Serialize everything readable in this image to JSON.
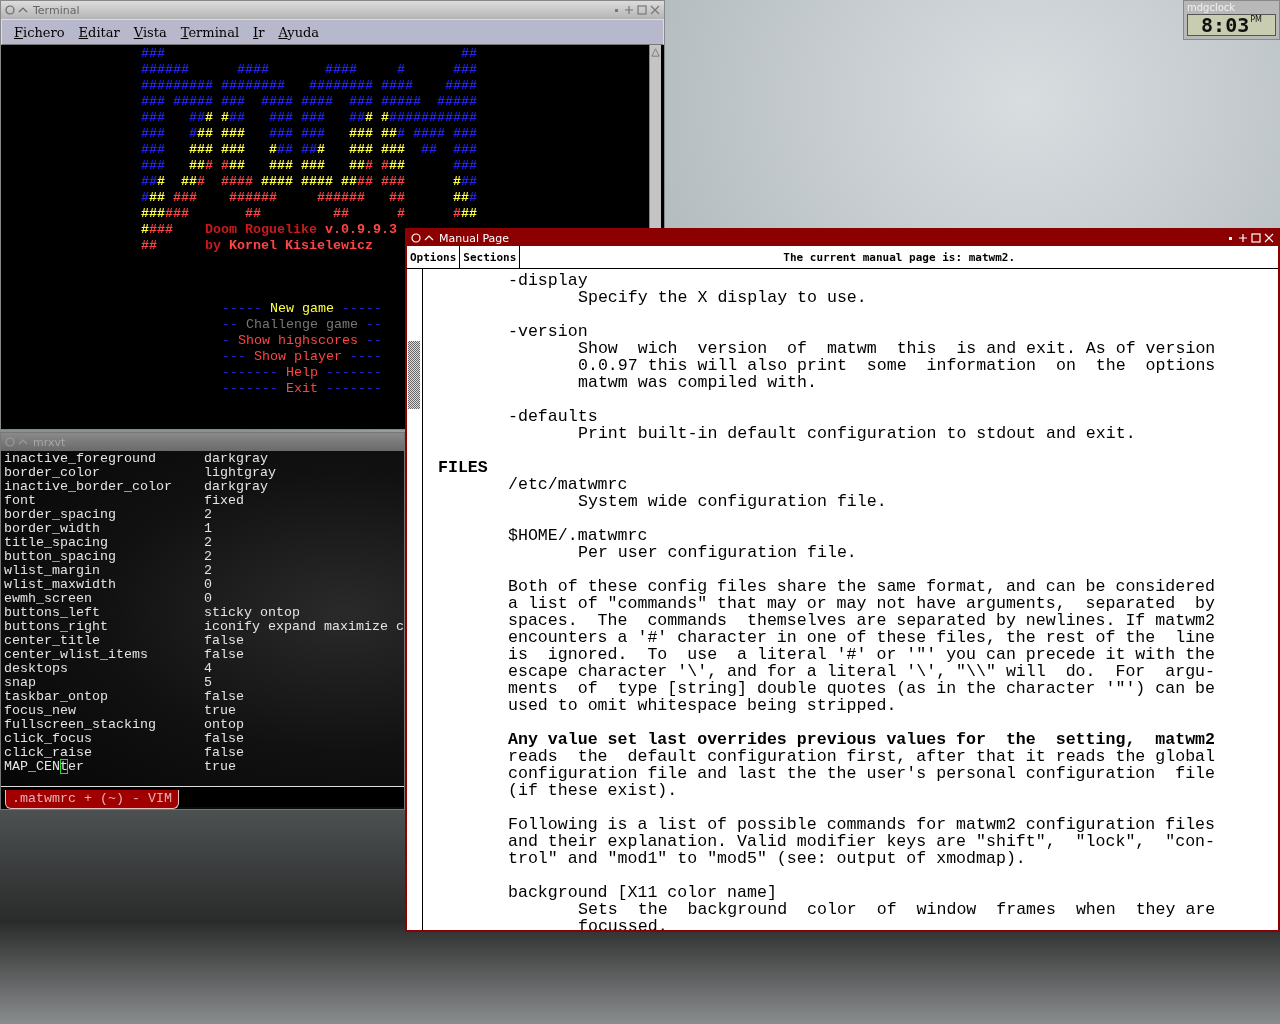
{
  "terminal": {
    "title": "Terminal",
    "menu": [
      "Fichero",
      "Editar",
      "Vista",
      "Terminal",
      "Ir",
      "Ayuda"
    ],
    "art": [
      {
        "segments": [
          {
            "text": "###                                     ##",
            "color": "#2424e8"
          }
        ]
      },
      {
        "segments": [
          {
            "text": "######      ####       ####     #      ###",
            "color": "#2424e8"
          }
        ]
      },
      {
        "segments": [
          {
            "text": "######### ########   ######## ####    ####",
            "color": "#2424e8"
          }
        ]
      },
      {
        "segments": [
          {
            "text": "### ##### ###  #### ####  ### #####  #####",
            "color": "#2424e8"
          }
        ]
      },
      {
        "segments": [
          {
            "text": "###   ##",
            "color": "#2424e8"
          },
          {
            "text": "# #",
            "color": "#ffff44"
          },
          {
            "text": "##   ### ###   ##",
            "color": "#2424e8"
          },
          {
            "text": "# #",
            "color": "#ffff44"
          },
          {
            "text": "###########",
            "color": "#2424e8"
          }
        ]
      },
      {
        "segments": [
          {
            "text": "###   #",
            "color": "#2424e8"
          },
          {
            "text": "## ###",
            "color": "#ffff44"
          },
          {
            "text": "   ### ###   ",
            "color": "#2424e8"
          },
          {
            "text": "### ##",
            "color": "#ffff44"
          },
          {
            "text": "# #### ###",
            "color": "#2424e8"
          }
        ]
      },
      {
        "segments": [
          {
            "text": "###   ",
            "color": "#2424e8"
          },
          {
            "text": "### ###   #",
            "color": "#ffff44"
          },
          {
            "text": "## ##",
            "color": "#2424e8"
          },
          {
            "text": "#   ### ###",
            "color": "#ffff44"
          },
          {
            "text": "  ##  ###",
            "color": "#2424e8"
          }
        ]
      },
      {
        "segments": [
          {
            "text": "###   ",
            "color": "#2424e8"
          },
          {
            "text": "##",
            "color": "#ffff44"
          },
          {
            "text": "# #",
            "color": "#ff4444"
          },
          {
            "text": "##   ### ###   ##",
            "color": "#ffff44"
          },
          {
            "text": "# #",
            "color": "#ff4444"
          },
          {
            "text": "##",
            "color": "#ffff44"
          },
          {
            "text": "      ###",
            "color": "#2424e8"
          }
        ]
      },
      {
        "segments": [
          {
            "text": "##",
            "color": "#2424e8"
          },
          {
            "text": "#  ##",
            "color": "#ffff44"
          },
          {
            "text": "#  ####",
            "color": "#ff4444"
          },
          {
            "text": " #### #### ##",
            "color": "#ffff44"
          },
          {
            "text": "## ###",
            "color": "#ff4444"
          },
          {
            "text": "      #",
            "color": "#ffff44"
          },
          {
            "text": "##",
            "color": "#2424e8"
          }
        ]
      },
      {
        "segments": [
          {
            "text": "#",
            "color": "#2424e8"
          },
          {
            "text": "##",
            "color": "#ffff44"
          },
          {
            "text": " ###    ######     ######   ##      ",
            "color": "#ff4444"
          },
          {
            "text": "##",
            "color": "#ffff44"
          },
          {
            "text": "#",
            "color": "#2424e8"
          }
        ]
      },
      {
        "segments": [
          {
            "text": "###",
            "color": "#ffff44"
          },
          {
            "text": "###       ##         ##      #      #",
            "color": "#ff4444"
          },
          {
            "text": "##",
            "color": "#ffff44"
          }
        ]
      },
      {
        "segments": [
          {
            "text": "#",
            "color": "#ffff44"
          },
          {
            "text": "###",
            "color": "#ff4444"
          },
          {
            "text": "    Doom Roguelike ",
            "color": "#c81c1c"
          },
          {
            "text": "v.0.9.9.3",
            "color": "#ff4444"
          }
        ]
      },
      {
        "segments": [
          {
            "text": "##",
            "color": "#ff4444"
          },
          {
            "text": "      by ",
            "color": "#c81c1c"
          },
          {
            "text": "Kornel Kisielewicz",
            "color": "#ff4444"
          }
        ]
      }
    ],
    "game_menu": [
      {
        "left": "-----",
        "label": "New game",
        "right": "-----",
        "selected": true,
        "disabled": false
      },
      {
        "left": "--",
        "label": "Challenge game",
        "right": "--",
        "selected": false,
        "disabled": true
      },
      {
        "left": "-",
        "label": "Show highscores",
        "right": "--",
        "selected": false,
        "disabled": false
      },
      {
        "left": "---",
        "label": "Show player",
        "right": "----",
        "selected": false,
        "disabled": false
      },
      {
        "left": "-------",
        "label": "Help",
        "right": "-------",
        "selected": false,
        "disabled": false
      },
      {
        "left": "-------",
        "label": "Exit",
        "right": "-------",
        "selected": false,
        "disabled": false
      }
    ]
  },
  "mrxvt": {
    "title": "mrxvt",
    "rows": [
      {
        "key": "inactive_foreground",
        "value": "darkgray"
      },
      {
        "key": "border_color",
        "value": "lightgray"
      },
      {
        "key": "inactive_border_color",
        "value": "darkgray"
      },
      {
        "key": "font",
        "value": "fixed"
      },
      {
        "key": "border_spacing",
        "value": "2"
      },
      {
        "key": "border_width",
        "value": "1"
      },
      {
        "key": "title_spacing",
        "value": "2"
      },
      {
        "key": "button_spacing",
        "value": "2"
      },
      {
        "key": "wlist_margin",
        "value": "2"
      },
      {
        "key": "wlist_maxwidth",
        "value": "0"
      },
      {
        "key": "ewmh_screen",
        "value": "0"
      },
      {
        "key": "buttons_left",
        "value": "sticky ontop"
      },
      {
        "key": "buttons_right",
        "value": "iconify expand maximize c"
      },
      {
        "key": "center_title",
        "value": "false"
      },
      {
        "key": "center_wlist_items",
        "value": "false"
      },
      {
        "key": "desktops",
        "value": "4"
      },
      {
        "key": "snap",
        "value": "5"
      },
      {
        "key": "taskbar_ontop",
        "value": "false"
      },
      {
        "key": "focus_new",
        "value": "true"
      },
      {
        "key": "fullscreen_stacking",
        "value": "ontop"
      },
      {
        "key": "click_focus",
        "value": "false"
      },
      {
        "key": "click_raise",
        "value": "false"
      },
      {
        "key": "MAP_CEN",
        "cursor_char": "t",
        "key_after_cursor": "er",
        "value": "true"
      }
    ],
    "tab": ".matwmrc + (~) - VIM"
  },
  "manual": {
    "title": "Manual Page",
    "buttons": [
      "Options",
      "Sections"
    ],
    "status": "The current manual page is: matwm2.",
    "blocks": [
      {
        "kind": "term",
        "lines": [
          "-display"
        ]
      },
      {
        "kind": "text",
        "lines": [
          "Specify the X display to use."
        ]
      },
      {
        "kind": "term",
        "lines": [
          "-version"
        ]
      },
      {
        "kind": "text",
        "lines": [
          "Show  wich  version  of  matwm  this  is and exit. As of version",
          "0.0.97 this will also print  some  information  on  the  options",
          "matwm was compiled with."
        ]
      },
      {
        "kind": "term",
        "lines": [
          "-defaults"
        ]
      },
      {
        "kind": "text",
        "lines": [
          "Print built-in default configuration to stdout and exit."
        ]
      },
      {
        "kind": "heading",
        "lines": [
          "FILES"
        ]
      },
      {
        "kind": "term",
        "lines": [
          "/etc/matwmrc"
        ]
      },
      {
        "kind": "text",
        "lines": [
          "System wide configuration file."
        ]
      },
      {
        "kind": "term",
        "lines": [
          "$HOME/.matwmrc"
        ]
      },
      {
        "kind": "text",
        "lines": [
          "Per user configuration file."
        ]
      },
      {
        "kind": "para",
        "lines": [
          "Both of these config files share the same format, and can be considered",
          "a list of \"commands\" that may or may not have arguments,  separated  by",
          "spaces.  The  commands  themselves are separated by newlines. If matwm2",
          "encounters a '#' character in one of these files, the rest of the  line",
          "is  ignored.  To  use  a literal '#' or '\"' you can precede it with the",
          "escape character '\\', and for a literal '\\', \"\\\\\" will  do.  For  argu-",
          "ments  of  type [string] double quotes (as in the character '\"') can be",
          "used to omit whitespace being stripped."
        ]
      },
      {
        "kind": "para",
        "lines": [
          "**Any value set last overrides previous values for  the  setting,  matwm2**",
          "reads  the  default configuration first, after that it reads the global",
          "configuration file and last the the user's personal configuration  file",
          "(if these exist)."
        ]
      },
      {
        "kind": "para",
        "lines": [
          "Following is a list of possible commands for matwm2 configuration files",
          "and their explanation. Valid modifier keys are \"shift\",  \"lock\",  \"con-",
          "trol\" and \"mod1\" to \"mod5\" (see: output of xmodmap)."
        ]
      },
      {
        "kind": "term",
        "lines": [
          "background [X11 color name]"
        ]
      },
      {
        "kind": "text",
        "lines": [
          "Sets  the  background  color  of  window  frames  when  they are",
          "focussed."
        ]
      }
    ]
  },
  "clock": {
    "title": "mdgclock",
    "time": "8:03",
    "ampm": "PM"
  }
}
